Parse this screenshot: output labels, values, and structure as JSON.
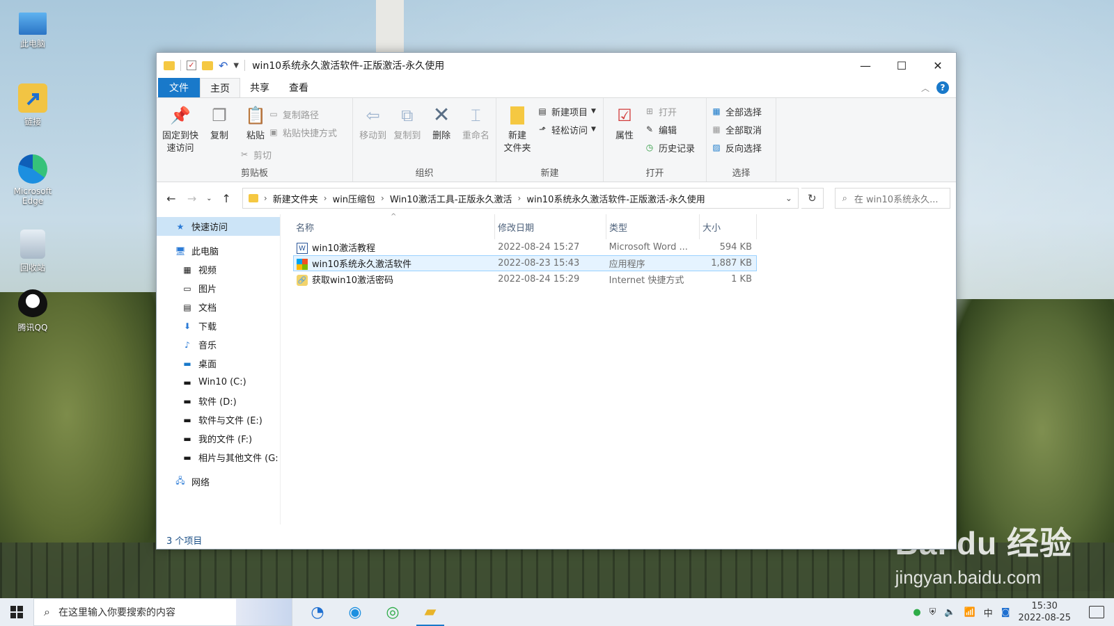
{
  "desktop": {
    "icons": [
      {
        "label": "此电脑",
        "icon": "pc-icon"
      },
      {
        "label": "链接",
        "icon": "shortcut-icon"
      },
      {
        "label": "Microsoft Edge",
        "icon": "edge-icon"
      },
      {
        "label": "回收站",
        "icon": "recycle-bin-icon"
      },
      {
        "label": "腾讯QQ",
        "icon": "qq-icon"
      }
    ],
    "watermark": {
      "brand": "Bai du 经验",
      "url": "jingyan.baidu.com"
    }
  },
  "window": {
    "title": "win10系统永久激活软件-正版激活-永久使用",
    "controls": {
      "minimize": "—",
      "maximize": "☐",
      "close": "✕"
    },
    "tabs": [
      "文件",
      "主页",
      "共享",
      "查看"
    ],
    "active_tab": "主页",
    "ribbon": {
      "clipboard": {
        "label": "剪贴板",
        "pin": "固定到快速访问",
        "pin_l1": "固定到快",
        "pin_l2": "速访问",
        "copy": "复制",
        "paste": "粘贴",
        "copy_path": "复制路径",
        "paste_shortcut": "粘贴快捷方式",
        "cut": "剪切"
      },
      "organize": {
        "label": "组织",
        "move_to": "移动到",
        "copy_to": "复制到",
        "delete": "删除",
        "rename": "重命名"
      },
      "new": {
        "label": "新建",
        "new_folder_l1": "新建",
        "new_folder_l2": "文件夹",
        "new_item": "新建项目",
        "easy_access": "轻松访问"
      },
      "open": {
        "label": "打开",
        "properties": "属性",
        "open": "打开",
        "edit": "编辑",
        "history": "历史记录"
      },
      "select": {
        "label": "选择",
        "select_all": "全部选择",
        "select_none": "全部取消",
        "invert": "反向选择"
      }
    },
    "address": {
      "crumbs": [
        "新建文件夹",
        "win压缩包",
        "Win10激活工具-正版永久激活",
        "win10系统永久激活软件-正版激活-永久使用"
      ],
      "search_placeholder": "在 win10系统永久..."
    },
    "nav_pane": {
      "quick_access": "快速访问",
      "this_pc": "此电脑",
      "items": [
        {
          "label": "视频",
          "icon": "video-icon"
        },
        {
          "label": "图片",
          "icon": "pictures-icon"
        },
        {
          "label": "文档",
          "icon": "documents-icon"
        },
        {
          "label": "下载",
          "icon": "download-icon"
        },
        {
          "label": "音乐",
          "icon": "music-icon"
        },
        {
          "label": "桌面",
          "icon": "desktop-icon"
        },
        {
          "label": "Win10 (C:)",
          "icon": "drive-c-icon"
        },
        {
          "label": "软件 (D:)",
          "icon": "drive-icon"
        },
        {
          "label": "软件与文件 (E:)",
          "icon": "drive-icon"
        },
        {
          "label": "我的文件 (F:)",
          "icon": "drive-icon"
        },
        {
          "label": "相片与其他文件 (G:",
          "icon": "drive-icon"
        }
      ],
      "network": "网络"
    },
    "columns": {
      "name": "名称",
      "date": "修改日期",
      "type": "类型",
      "size": "大小"
    },
    "files": [
      {
        "name": "win10激活教程",
        "date": "2022-08-24 15:27",
        "type": "Microsoft Word ...",
        "size": "594 KB",
        "icon": "word-doc-icon",
        "selected": false
      },
      {
        "name": "win10系统永久激活软件",
        "date": "2022-08-23 15:43",
        "type": "应用程序",
        "size": "1,887 KB",
        "icon": "app-icon",
        "selected": true
      },
      {
        "name": "获取win10激活密码",
        "date": "2022-08-24 15:29",
        "type": "Internet 快捷方式",
        "size": "1 KB",
        "icon": "internet-shortcut-icon",
        "selected": false
      }
    ],
    "status": "3 个项目"
  },
  "taskbar": {
    "search_placeholder": "在这里输入你要搜索的内容",
    "time": "15:30",
    "date": "2022-08-25"
  }
}
